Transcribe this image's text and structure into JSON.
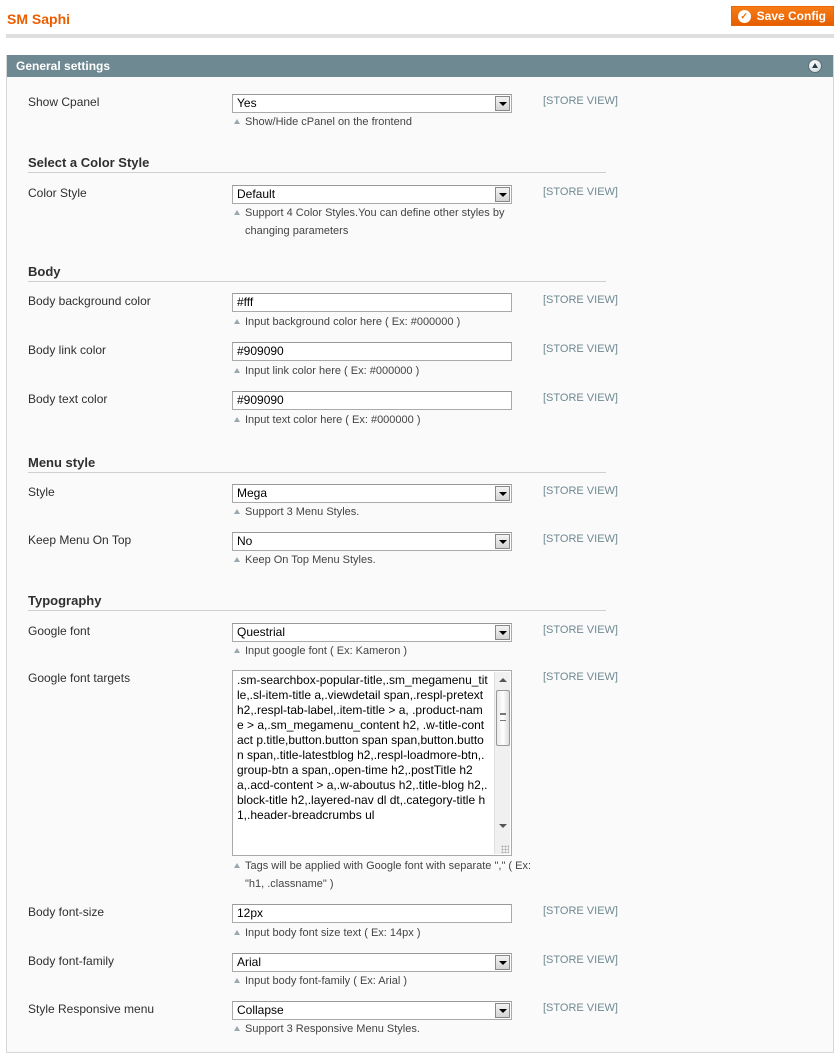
{
  "header": {
    "title": "SM Saphi",
    "save_label": "Save Config",
    "accent_color": "#eb5e00"
  },
  "section": {
    "title": "General settings",
    "collapse_icon": "collapse-up-icon"
  },
  "scope_label": "[STORE VIEW]",
  "groups": {
    "color_style": "Select a Color Style",
    "body": "Body",
    "menu": "Menu style",
    "typography": "Typography"
  },
  "fields": {
    "show_cpanel": {
      "label": "Show Cpanel",
      "value": "Yes",
      "note": "Show/Hide cPanel on the frontend"
    },
    "color_style": {
      "label": "Color Style",
      "value": "Default",
      "note": "Support 4 Color Styles.You can define other styles by changing parameters"
    },
    "body_bg": {
      "label": "Body background color",
      "value": "#fff",
      "note": "Input background color here ( Ex: #000000 )"
    },
    "body_link": {
      "label": "Body link color",
      "value": "#909090",
      "note": "Input link color here ( Ex: #000000 )"
    },
    "body_text": {
      "label": "Body text color",
      "value": "#909090",
      "note": "Input text color here ( Ex: #000000 )"
    },
    "menu_style": {
      "label": "Style",
      "value": "Mega",
      "note": "Support 3 Menu Styles."
    },
    "keep_menu": {
      "label": "Keep Menu On Top",
      "value": "No",
      "note": "Keep On Top Menu Styles."
    },
    "google_font": {
      "label": "Google font",
      "value": "Questrial",
      "note": "Input google font ( Ex: Kameron )"
    },
    "google_targets": {
      "label": "Google font targets",
      "value": ".sm-searchbox-popular-title,.sm_megamenu_title,.sl-item-title a,.viewdetail span,.respl-pretext h2,.respl-tab-label,.item-title > a, .product-name > a,.sm_megamenu_content  h2, .w-title-contact p.title,button.button span span,button.button span,.title-latestblog h2,.respl-loadmore-btn,.group-btn a span,.open-time h2,.postTitle h2 a,.acd-content > a,.w-aboutus  h2,.title-blog h2,.block-title h2,.layered-nav dl dt,.category-title h1,.header-breadcrumbs ul",
      "note": "Tags will be applied with Google font with separate \",\" ( Ex: \"h1, .classname\" )"
    },
    "font_size": {
      "label": "Body font-size",
      "value": "12px",
      "note": "Input body font size text ( Ex: 14px )"
    },
    "font_family": {
      "label": "Body font-family",
      "value": "Arial",
      "note": "Input body font-family ( Ex: Arial )"
    },
    "responsive_menu": {
      "label": "Style Responsive menu",
      "value": "Collapse",
      "note": "Support 3 Responsive Menu Styles."
    }
  }
}
